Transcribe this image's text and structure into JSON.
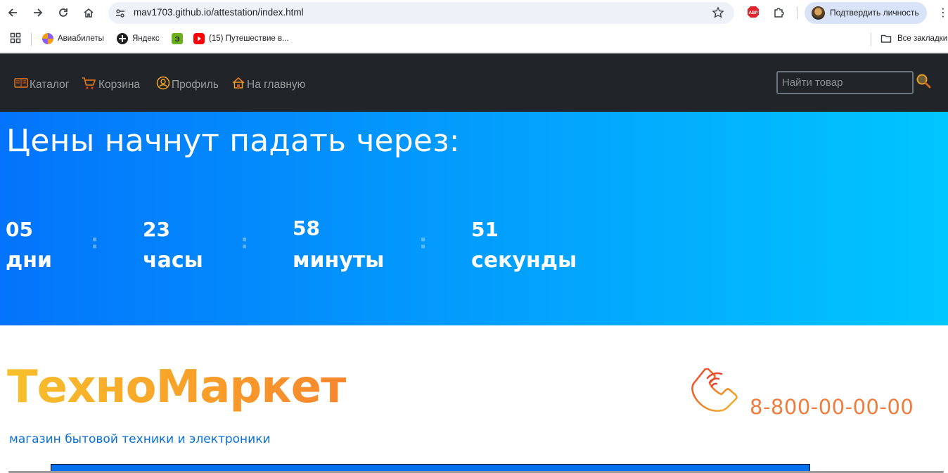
{
  "browser": {
    "url": "mav1703.github.io/attestation/index.html",
    "profile_label": "Подтвердить личность",
    "bookmarks": [
      {
        "label": "Авиабилеты",
        "icon": "aviasales-icon"
      },
      {
        "label": "Яндекс",
        "icon": "yandex-icon"
      },
      {
        "label": "",
        "icon": "evernote-icon"
      },
      {
        "label": "(15) Путешествие в...",
        "icon": "youtube-icon"
      }
    ],
    "all_bookmarks": "Все закладки"
  },
  "navbar": {
    "links": [
      "Каталог",
      "Корзина",
      "Профиль",
      "На главную"
    ],
    "search_placeholder": "Найти товар"
  },
  "banner": {
    "title": "Цены начнут падать через:",
    "countdown": [
      {
        "value": "05",
        "label": "дни"
      },
      {
        "value": "23",
        "label": "часы"
      },
      {
        "value": "58",
        "label": "минуты"
      },
      {
        "value": "51",
        "label": "секунды"
      }
    ],
    "separator": ":"
  },
  "header": {
    "brand": "ТехноМаркет",
    "tagline": "магазин бытовой техники и электроники",
    "phone": "8-800-00-00-00"
  },
  "colors": {
    "navbar_bg": "#212529",
    "banner_start": "#0374fb",
    "banner_end": "#00c6ff",
    "brand_gradient_start": "#f7c02b",
    "brand_gradient_end": "#f7862e",
    "tagline": "#0a6fd6",
    "phone": "#f07d3e"
  }
}
